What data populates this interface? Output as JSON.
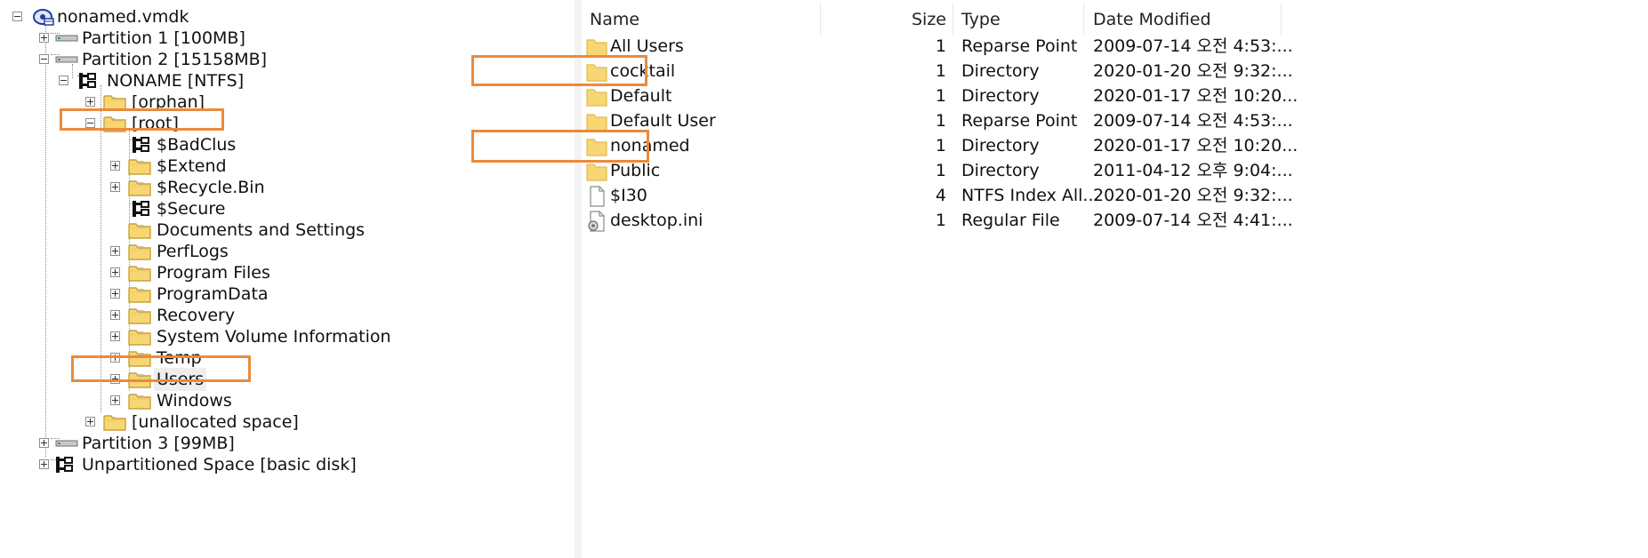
{
  "tree": {
    "items": [
      {
        "label": "nonamed.vmdk",
        "icon": "disk-image-icon",
        "expander": "minus",
        "level": 0
      },
      {
        "label": "Partition 1 [100MB]",
        "icon": "partition-icon",
        "expander": "plus",
        "level": 1
      },
      {
        "label": "Partition 2 [15158MB]",
        "icon": "partition-icon",
        "expander": "minus",
        "level": 1
      },
      {
        "label": "NONAME [NTFS]",
        "icon": "volume-icon",
        "expander": "minus",
        "level": 2
      },
      {
        "label": "[orphan]",
        "icon": "folder-icon",
        "expander": "plus",
        "level": 3
      },
      {
        "label": "[root]",
        "icon": "folder-icon",
        "expander": "minus",
        "level": 3
      },
      {
        "label": "$BadClus",
        "icon": "file-tree-icon",
        "expander": "none",
        "level": 4
      },
      {
        "label": "$Extend",
        "icon": "folder-icon",
        "expander": "plus",
        "level": 4
      },
      {
        "label": "$Recycle.Bin",
        "icon": "folder-icon",
        "expander": "plus",
        "level": 4
      },
      {
        "label": "$Secure",
        "icon": "file-tree-icon",
        "expander": "none",
        "level": 4
      },
      {
        "label": "Documents and Settings",
        "icon": "folder-icon",
        "expander": "none",
        "level": 4
      },
      {
        "label": "PerfLogs",
        "icon": "folder-icon",
        "expander": "plus",
        "level": 4
      },
      {
        "label": "Program Files",
        "icon": "folder-icon",
        "expander": "plus",
        "level": 4
      },
      {
        "label": "ProgramData",
        "icon": "folder-icon",
        "expander": "plus",
        "level": 4
      },
      {
        "label": "Recovery",
        "icon": "folder-icon",
        "expander": "plus",
        "level": 4
      },
      {
        "label": "System Volume Information",
        "icon": "folder-icon",
        "expander": "plus",
        "level": 4
      },
      {
        "label": "Temp",
        "icon": "folder-icon",
        "expander": "plus",
        "level": 4
      },
      {
        "label": "Users",
        "icon": "folder-icon",
        "expander": "plus",
        "level": 4,
        "selected": true
      },
      {
        "label": "Windows",
        "icon": "folder-icon",
        "expander": "plus",
        "level": 4
      },
      {
        "label": "[unallocated space]",
        "icon": "folder-icon",
        "expander": "plus",
        "level": 3
      },
      {
        "label": "Partition 3 [99MB]",
        "icon": "partition-icon",
        "expander": "plus",
        "level": 1
      },
      {
        "label": "Unpartitioned Space [basic disk]",
        "icon": "volume-icon",
        "expander": "plus",
        "level": 1
      }
    ]
  },
  "list": {
    "columns": {
      "name": "Name",
      "size": "Size",
      "type": "Type",
      "date": "Date Modified"
    },
    "rows": [
      {
        "name": "All Users",
        "size": "1",
        "type": "Reparse Point",
        "date": "2009-07-14 오전 4:53:...",
        "icon": "folder-icon"
      },
      {
        "name": "cocktail",
        "size": "1",
        "type": "Directory",
        "date": "2020-01-20 오전 9:32:...",
        "icon": "folder-icon"
      },
      {
        "name": "Default",
        "size": "1",
        "type": "Directory",
        "date": "2020-01-17 오전 10:20...",
        "icon": "folder-icon"
      },
      {
        "name": "Default User",
        "size": "1",
        "type": "Reparse Point",
        "date": "2009-07-14 오전 4:53:...",
        "icon": "folder-icon"
      },
      {
        "name": "nonamed",
        "size": "1",
        "type": "Directory",
        "date": "2020-01-17 오전 10:20...",
        "icon": "folder-icon"
      },
      {
        "name": "Public",
        "size": "1",
        "type": "Directory",
        "date": "2011-04-12 오후 9:04:...",
        "icon": "folder-icon"
      },
      {
        "name": "$I30",
        "size": "4",
        "type": "NTFS Index All...",
        "date": "2020-01-20 오전 9:32:...",
        "icon": "file-icon"
      },
      {
        "name": "desktop.ini",
        "size": "1",
        "type": "Regular File",
        "date": "2009-07-14 오전 4:41:...",
        "icon": "settings-file-icon"
      }
    ]
  },
  "colors": {
    "highlight": "#ea8a3c",
    "folder": "#f7d774",
    "folder_edge": "#c9a13d"
  }
}
